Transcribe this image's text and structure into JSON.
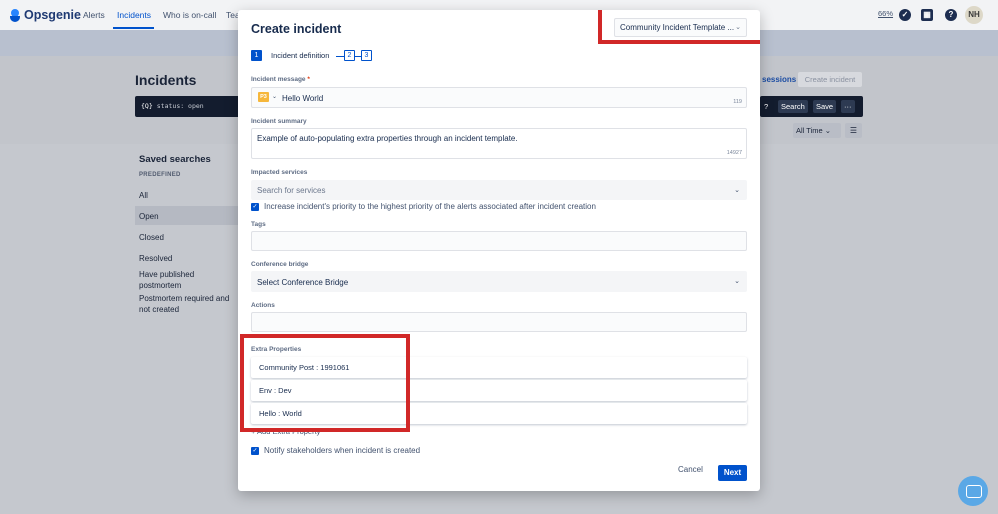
{
  "app": {
    "brand": "Opsgenie",
    "nav": [
      "Alerts",
      "Incidents",
      "Who is on-call",
      "Tea"
    ],
    "zoom": "66%",
    "user_initials": "NH"
  },
  "page": {
    "title": "Incidents",
    "query_icon": "{Q}",
    "query": "status: open",
    "sessions_link": "sessions",
    "create_button": "Create incident",
    "help": "?",
    "search_button": "Search",
    "save_button": "Save",
    "more_button": "···",
    "time_filter": "All Time",
    "time_filter_chevron": "⌄"
  },
  "saved_searches": {
    "title": "Saved searches",
    "section": "PREDEFINED",
    "items": [
      "All",
      "Open",
      "Closed",
      "Resolved",
      "Have published postmortem",
      "Postmortem required and not created"
    ]
  },
  "modal": {
    "title": "Create incident",
    "template_select": "Community Incident Template ...",
    "steps": {
      "current": "1",
      "current_label": "Incident definition",
      "next": [
        "2",
        "3"
      ]
    },
    "message": {
      "label": "Incident message",
      "required": "*",
      "priority": "P3",
      "value": "Hello World",
      "counter": "119"
    },
    "summary": {
      "label": "Incident summary",
      "value": "Example of auto-populating extra properties through an incident template.",
      "counter": "14927"
    },
    "services": {
      "label": "Impacted services",
      "placeholder": "Search for services"
    },
    "increase_priority": "Increase incident's priority to the highest priority of the alerts associated after incident creation",
    "tags": {
      "label": "Tags",
      "value": ""
    },
    "conference": {
      "label": "Conference bridge",
      "value": "Select Conference Bridge"
    },
    "actions": {
      "label": "Actions",
      "value": ""
    },
    "extra_properties": {
      "label": "Extra Properties",
      "items": [
        "Community Post : 1991061",
        "Env : Dev",
        "Hello : World"
      ],
      "add_link": "+ Add Extra Property"
    },
    "notify": "Notify stakeholders when incident is created",
    "cancel": "Cancel",
    "next": "Next"
  },
  "colors": {
    "primary": "#0052cc",
    "highlight": "#d12828",
    "priority_p3": "#f6b73c",
    "nav_dark": "#131c2e"
  }
}
